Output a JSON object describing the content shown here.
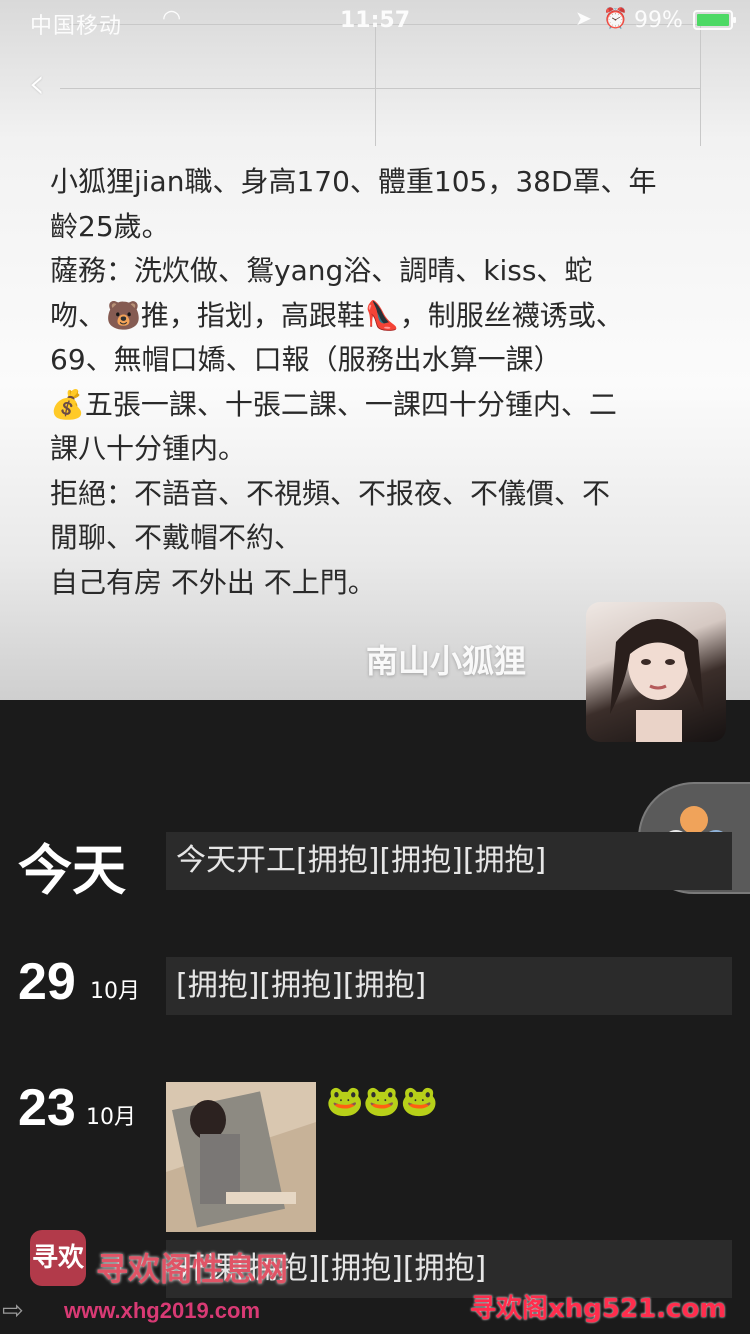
{
  "status_bar": {
    "carrier": "中国移动",
    "time": "11:57",
    "battery_percent": "99%",
    "battery_level": 0.99
  },
  "profile": {
    "signature_lines": [
      "小狐狸jian職、身高170、體重105，38D罩、年",
      "齡25歲。",
      "薩務：洗炊做、鴛yang浴、調晴、kiss、蛇",
      "吻、🐻推，指划，高跟鞋👠，制服丝襪诱或、",
      "69、無帽口嬌、口報（服務出水算一課）",
      "💰五張一課、十張二課、一課四十分锺内、二",
      "課八十分锺内。",
      "拒絕：不語音、不視頻、不报夜、不儀價、不",
      "閒聊、不戴帽不約、",
      "自己有房 不外出 不上門。"
    ],
    "nickname": "南山小狐狸"
  },
  "moments": {
    "today_label": "今天",
    "today_text": "今天开工[拥抱][拥抱][拥抱]",
    "entry2": {
      "day": "29",
      "month": "10月",
      "text": "[拥抱][拥抱][拥抱]"
    },
    "entry3": {
      "day": "23",
      "month": "10月",
      "emojis": "🐸🐸🐸",
      "text": "开课[拥抱][拥抱][拥抱]"
    }
  },
  "watermarks": {
    "logo_text": "寻欢",
    "site_name": "寻欢阁性息网",
    "url_left": "www.xhg2019.com",
    "url_right": "寻欢阁xhg521.com"
  },
  "colors": {
    "dark_bg": "#1b1b1b",
    "bubble_bg": "#2b2b2b",
    "battery_green": "#4cd964"
  }
}
